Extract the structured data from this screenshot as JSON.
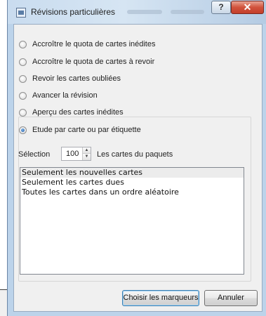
{
  "window": {
    "title": "Révisions particulières",
    "help_glyph": "?",
    "close_glyph": "✕"
  },
  "options": [
    {
      "label": "Accroître le quota de cartes inédites",
      "checked": false
    },
    {
      "label": "Accroître le quota de cartes à revoir",
      "checked": false
    },
    {
      "label": "Revoir les cartes oubliées",
      "checked": false
    },
    {
      "label": "Avancer la révision",
      "checked": false
    },
    {
      "label": "Aperçu des cartes inédites",
      "checked": false
    },
    {
      "label": "Etude par carte ou par étiquette",
      "checked": true
    }
  ],
  "selection": {
    "label": "Sélection",
    "value": "100",
    "suffix": "Les cartes du paquets"
  },
  "list": {
    "items": [
      "Seulement les nouvelles cartes",
      "Seulement les cartes dues",
      "Toutes les cartes dans un ordre aléatoire"
    ],
    "selected_index": 0
  },
  "buttons": {
    "choose_tags": "Choisir les marqueurs",
    "cancel": "Annuler"
  },
  "icons": {
    "window_icon": "deck-icon",
    "spin_up": "spin-up-arrow-icon",
    "spin_down": "spin-down-arrow-icon"
  }
}
